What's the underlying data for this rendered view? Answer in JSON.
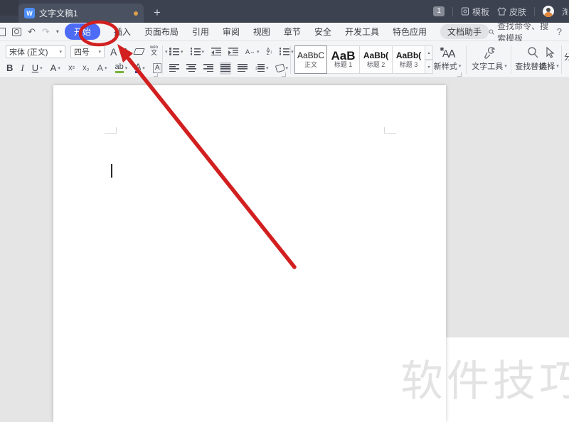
{
  "colors": {
    "accent_blue": "#4e6bf5",
    "annotation_red": "#d21f1f",
    "titlebar": "#3d4250"
  },
  "icons": {
    "chevron": "▾",
    "up": "▴",
    "plus": "+",
    "undo": "↶",
    "redo": "↷",
    "help": "?",
    "arrow_lr": "↔",
    "arrow_ud": "↕",
    "down": "↓",
    "star": "*"
  },
  "titlebar": {
    "tab_title": "文字文稿1",
    "doc_icon_letter": "W",
    "window_badge": "1",
    "template_label": "模板",
    "skin_label": "皮肤",
    "user_partial": "淘"
  },
  "menubar": {
    "items": [
      "开始",
      "插入",
      "页面布局",
      "引用",
      "审阅",
      "视图",
      "章节",
      "安全",
      "开发工具",
      "特色应用",
      "文档助手"
    ],
    "active_item": "开始",
    "circled_item": "插入",
    "search_text": "查找命令、搜索模板"
  },
  "toolbar": {
    "font_family": "宋体 (正文)",
    "font_size": "四号",
    "grow_font": "A",
    "shrink_font": "A",
    "pinyin_top": "wén",
    "pinyin_char": "文",
    "bold": "B",
    "italic": "I",
    "underline": "U",
    "char_style": "A",
    "superscript": "X²",
    "subscript": "X₂",
    "text_effect": "A",
    "highlight": "ab",
    "font_color": "A",
    "char_border": "A",
    "scale_letter": "A",
    "sort_a": "A",
    "sort_z": "Z",
    "styles": [
      {
        "preview": "AaBbC",
        "label": "正文"
      },
      {
        "preview": "AaB",
        "label": "标题 1"
      },
      {
        "preview": "AaBb(",
        "label": "标题 2"
      },
      {
        "preview": "AaBb(",
        "label": "标题 3"
      }
    ],
    "new_style": "新样式",
    "text_tool": "文字工具",
    "find_replace": "查找替换",
    "select_tool": "选择",
    "clipped_right": "分"
  },
  "document": {
    "watermark": "软件技巧"
  }
}
